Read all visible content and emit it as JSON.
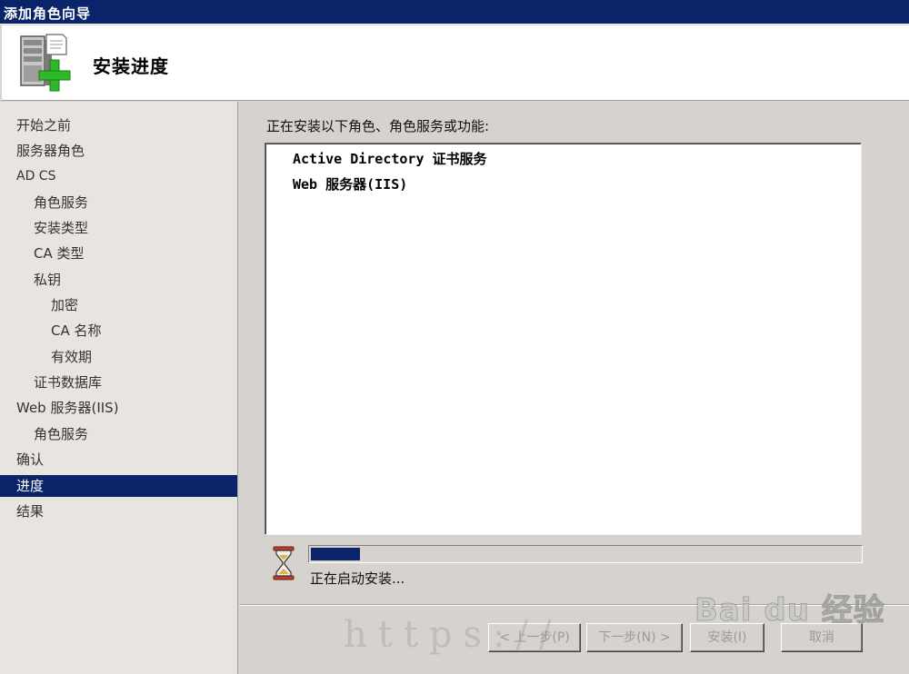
{
  "window": {
    "title": "添加角色向导"
  },
  "banner": {
    "title": "安装进度",
    "icon": "server-add-role-icon"
  },
  "sidebar": {
    "items": [
      {
        "label": "开始之前",
        "level": 0,
        "active": false
      },
      {
        "label": "服务器角色",
        "level": 0,
        "active": false
      },
      {
        "label": "AD CS",
        "level": 0,
        "active": false
      },
      {
        "label": "角色服务",
        "level": 1,
        "active": false
      },
      {
        "label": "安装类型",
        "level": 1,
        "active": false
      },
      {
        "label": "CA 类型",
        "level": 1,
        "active": false
      },
      {
        "label": "私钥",
        "level": 1,
        "active": false
      },
      {
        "label": "加密",
        "level": 2,
        "active": false
      },
      {
        "label": "CA 名称",
        "level": 2,
        "active": false
      },
      {
        "label": "有效期",
        "level": 2,
        "active": false
      },
      {
        "label": "证书数据库",
        "level": 1,
        "active": false
      },
      {
        "label": "Web 服务器(IIS)",
        "level": 0,
        "active": false
      },
      {
        "label": "角色服务",
        "level": 1,
        "active": false
      },
      {
        "label": "确认",
        "level": 0,
        "active": false
      },
      {
        "label": "进度",
        "level": 0,
        "active": true
      },
      {
        "label": "结果",
        "level": 0,
        "active": false
      }
    ]
  },
  "main": {
    "heading": "正在安装以下角色、角色服务或功能:",
    "installing": [
      "Active Directory 证书服务",
      "Web 服务器(IIS)"
    ],
    "progress": {
      "fraction": 0.09,
      "status": "正在启动安装..."
    }
  },
  "buttons": {
    "back": "< 上一步(P)",
    "next": "下一步(N) >",
    "install": "安装(I)",
    "cancel": "取消"
  },
  "watermark": {
    "url": "https://",
    "logo": "Bai du 经验"
  },
  "colors": {
    "titlebar": "#0a246a",
    "selection": "#0a246a",
    "progress": "#0a246a",
    "face": "#d6d3ce"
  }
}
